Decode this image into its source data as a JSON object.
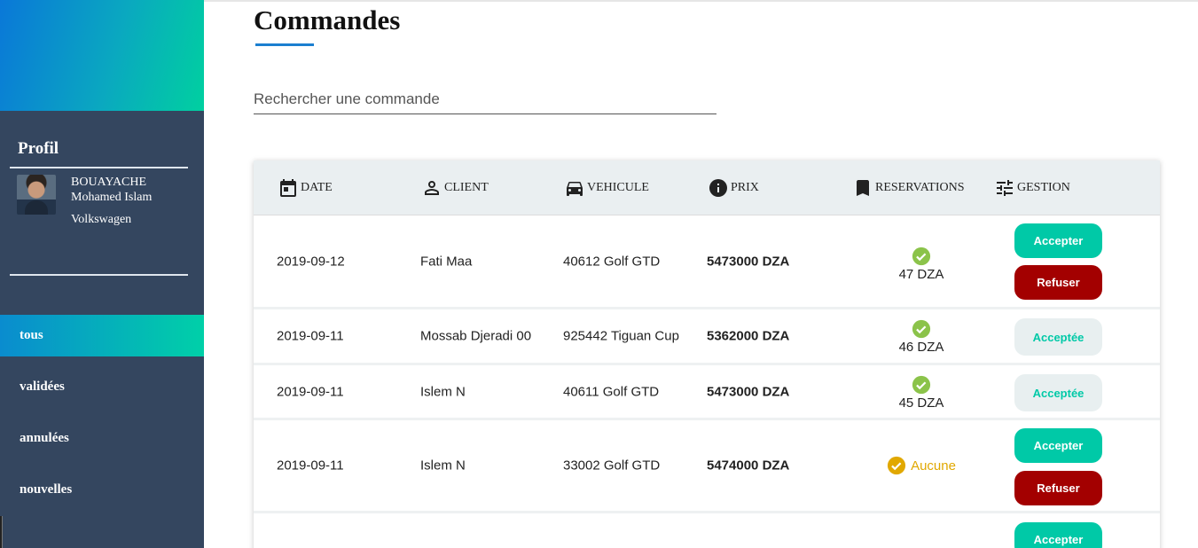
{
  "sidebar": {
    "profile_heading": "Profil",
    "user_lastname": "BOUAYACHE",
    "user_firstname": "Mohamed Islam",
    "company": "Volkswagen",
    "nav": [
      {
        "label": "tous",
        "active": true
      },
      {
        "label": "validées",
        "active": false
      },
      {
        "label": "annulées",
        "active": false
      },
      {
        "label": "nouvelles",
        "active": false
      }
    ]
  },
  "main": {
    "title": "Commandes",
    "search_placeholder": "Rechercher une commande",
    "table": {
      "headers": {
        "date": "DATE",
        "client": "CLIENT",
        "vehicule": "VEHICULE",
        "prix": "PRIX",
        "reservations": "RESERVATIONS",
        "gestion": "GESTION"
      },
      "rows": [
        {
          "date": "2019-09-12",
          "client": "Fati Maa",
          "vehicule": "40612 Golf GTD",
          "prix": "5473000 DZA",
          "reservation": "47 DZA",
          "status": "pending"
        },
        {
          "date": "2019-09-11",
          "client": "Mossab Djeradi 00",
          "vehicule": "925442 Tiguan Cup",
          "prix": "5362000 DZA",
          "reservation": "46 DZA",
          "status": "accepted"
        },
        {
          "date": "2019-09-11",
          "client": "Islem N",
          "vehicule": "40611 Golf GTD",
          "prix": "5473000 DZA",
          "reservation": "45 DZA",
          "status": "accepted"
        },
        {
          "date": "2019-09-11",
          "client": "Islem N",
          "vehicule": "33002 Golf GTD",
          "prix": "5474000 DZA",
          "reservation": "Aucune",
          "status": "pending"
        },
        {
          "date": "",
          "client": "",
          "vehicule": "",
          "prix": "",
          "reservation": "",
          "status": "pending"
        }
      ]
    },
    "buttons": {
      "accept": "Accepter",
      "refuse": "Refuser",
      "accepted": "Acceptée"
    }
  },
  "colors": {
    "sidebar_bg": "#34465f",
    "accent_teal": "#00c9a7",
    "refuse_red": "#a30000",
    "check_green": "#8bc34a",
    "none_yellow": "#e1a800"
  }
}
